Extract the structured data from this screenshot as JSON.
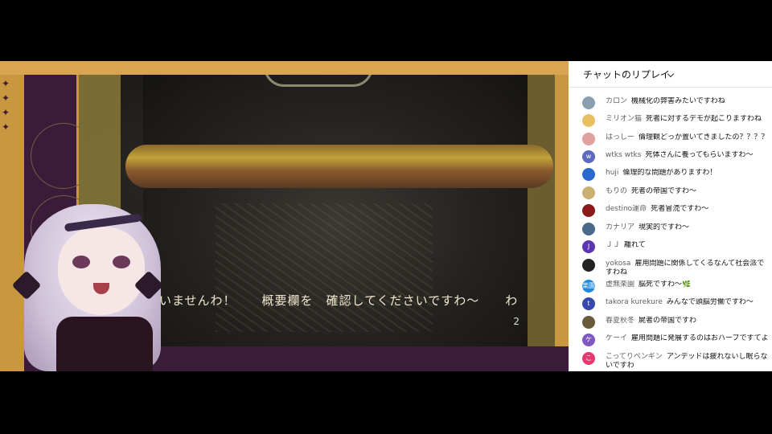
{
  "video": {
    "caption": "いませんわ！　　概要欄を　確認してくださいですわ〜　　わ",
    "counter": "2"
  },
  "chat": {
    "title": "チャットのリプレイ",
    "messages": [
      {
        "name": "カロン",
        "text": "機械化の弊害みたいですわね",
        "avatar_color": "#8aa0b0",
        "avatar_label": ""
      },
      {
        "name": "ミリオン猫",
        "text": "死者に対するデモが起こりますわね",
        "avatar_color": "#e8c060",
        "avatar_label": ""
      },
      {
        "name": "はっしー",
        "text": "倫理観どっか置いてきましたの？？？？",
        "avatar_color": "#e0a0a0",
        "avatar_label": ""
      },
      {
        "name": "wtks wtks",
        "text": "死体さんに養ってもらいますわ〜",
        "avatar_color": "#5c6bc0",
        "avatar_label": "w"
      },
      {
        "name": "huji",
        "text": "倫理的な問題がありますわ！",
        "avatar_color": "#2a6ad0",
        "avatar_label": ""
      },
      {
        "name": "もりの",
        "text": "死者の帝国ですわ〜",
        "avatar_color": "#c8b070",
        "avatar_label": ""
      },
      {
        "name": "destino運命",
        "text": "死者冒涜ですわ〜",
        "avatar_color": "#8a1a1a",
        "avatar_label": ""
      },
      {
        "name": "カナリア",
        "text": "現実的ですわ〜",
        "avatar_color": "#4a6a8a",
        "avatar_label": ""
      },
      {
        "name": "ＪＪ",
        "text": "離れて",
        "avatar_color": "#5e35b1",
        "avatar_label": "J"
      },
      {
        "name": "yokosa",
        "text": "雇用問題に関係してくるなんて社会派ですわね",
        "avatar_color": "#222222",
        "avatar_label": ""
      },
      {
        "name": "虚無楽園",
        "text": "脳死ですわ〜🌿",
        "avatar_color": "#1e88e5",
        "avatar_label": "楽園"
      },
      {
        "name": "takora kurekure",
        "text": "みんなで頭脳労働ですわ〜",
        "avatar_color": "#3949ab",
        "avatar_label": "t"
      },
      {
        "name": "春夏秋冬",
        "text": "屍者の帝国ですわ",
        "avatar_color": "#6a5a3a",
        "avatar_label": ""
      },
      {
        "name": "ケーイ",
        "text": "雇用問題に発展するのはおハーブですてよ",
        "avatar_color": "#7e57c2",
        "avatar_label": "ケ"
      },
      {
        "name": "こってりペンギン",
        "text": "アンデッドは疲れないし眠らないですわ",
        "avatar_color": "#e53970",
        "avatar_label": "こ"
      }
    ]
  }
}
